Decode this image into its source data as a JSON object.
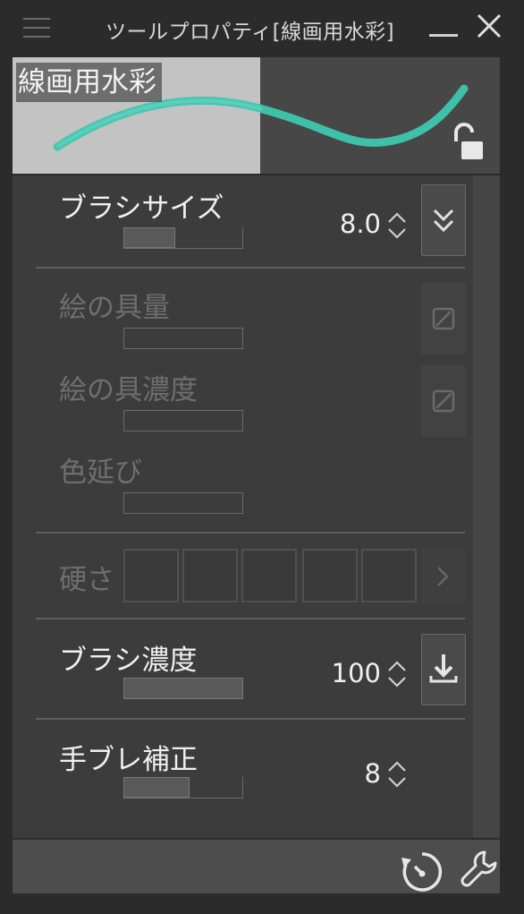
{
  "window": {
    "title": "ツールプロパティ[線画用水彩]",
    "menu_icon": "hamburger-menu-icon",
    "minimize_icon": "minimize-icon",
    "close_icon": "close-icon"
  },
  "preview": {
    "label": "線画用水彩",
    "stroke_color": "#3fc7b0",
    "lock_icon": "unlocked-padlock-icon"
  },
  "properties": {
    "brush_size": {
      "label": "ブラシサイズ",
      "value": "8.0",
      "slider_fraction": 0.44,
      "button_icon": "double-chevron-down-icon"
    },
    "paint_amount": {
      "label": "絵の具量",
      "button_icon": "disabled-slash-icon"
    },
    "paint_density": {
      "label": "絵の具濃度",
      "button_icon": "disabled-slash-icon"
    },
    "color_stretch": {
      "label": "色延び"
    },
    "hardness": {
      "label": "硬さ",
      "cells": 5,
      "button_icon": "chevron-right-icon"
    },
    "brush_density": {
      "label": "ブラシ濃度",
      "value": "100",
      "slider_fraction": 1.0,
      "button_icon": "download-tray-icon"
    },
    "stabilization": {
      "label": "手ブレ補正",
      "value": "8",
      "slider_fraction": 0.55
    }
  },
  "footer": {
    "icons": [
      "reset-timer-icon",
      "wrench-settings-icon"
    ]
  },
  "colors": {
    "background": "#2b2b2b",
    "panel": "#3c3c3c",
    "accent_teal": "#3fc7b0",
    "disabled_text": "#6e6e6e"
  }
}
